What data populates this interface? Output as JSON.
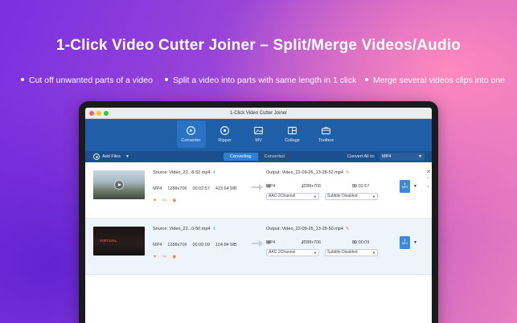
{
  "promo": {
    "title": "1-Click Video Cutter Joiner – Split/Merge Videos/Audio",
    "features": [
      "Cut off unwanted parts of a video",
      "Split a video into parts with same length in 1 click",
      "Merge several videos clips into one"
    ]
  },
  "window": {
    "title": "1-Click Video Cutter Joiner"
  },
  "nav": [
    {
      "label": "Converter",
      "icon": "converter-icon",
      "active": true
    },
    {
      "label": "Ripper",
      "icon": "ripper-icon",
      "active": false
    },
    {
      "label": "MV",
      "icon": "mv-icon",
      "active": false
    },
    {
      "label": "Collage",
      "icon": "collage-icon",
      "active": false
    },
    {
      "label": "Toolbox",
      "icon": "toolbox-icon",
      "active": false
    }
  ],
  "toolbar": {
    "add_files": "Add Files",
    "tab_converting": "Converting",
    "tab_converted": "Converted",
    "convert_all_label": "Convert All to:",
    "convert_all_value": "MP4"
  },
  "files": [
    {
      "source": "Source: Video_22...8-52.mp4",
      "format": "MP4",
      "resolution": "1288x706",
      "duration": "00:02:57",
      "size": "423.64 MB",
      "output": "Output: Video_22-09-26_13-28-52.mp4",
      "out_format": "MP4",
      "out_resolution": "1288x706",
      "out_duration": "00:02:57",
      "audio": "AAC-2Channel",
      "subtitle": "Subtitle Disabled",
      "thumb_text": ""
    },
    {
      "source": "Source: Video_22...0-50.mp4",
      "format": "MP4",
      "resolution": "1288x706",
      "duration": "00:00:09",
      "size": "104.84 MB",
      "output": "Output: Video_22-09-26_13-28-50.mp4",
      "out_format": "MP4",
      "out_resolution": "1288x706",
      "out_duration": "00:00:09",
      "audio": "AAC-2Channel",
      "subtitle": "Subtitle Disabled",
      "thumb_text": "VIRTUAL"
    }
  ],
  "colors": {
    "nav_bg": "#1f5fa8",
    "subbar_bg": "#1b4f8f",
    "accent": "#2d7fd6",
    "tool_orange": "#e37b3a"
  }
}
